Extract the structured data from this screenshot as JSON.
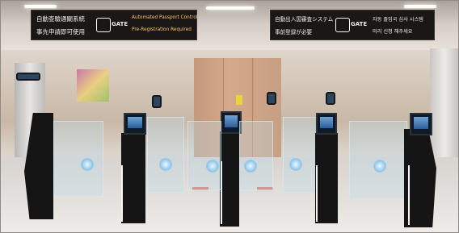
{
  "signs": {
    "left": {
      "line1_cjk": "自動查驗通關系統",
      "line2_cjk": "事先申請即可使用",
      "logo": "GATE",
      "line1_en": "Automated Passport Control",
      "line2_en": "Pre-Registration Required"
    },
    "right": {
      "line1_jp": "自動出入国審査システム",
      "line2_jp": "事前登録が必要",
      "logo": "GATE",
      "line1_kr": "자동 출입국 심사 시스템",
      "line2_kr": "미리 신청 해주세요"
    }
  },
  "colors": {
    "sign_bg": "#1b1716",
    "sign_text": "#f2ede3",
    "gate_body": "#151515",
    "screen_blue": "#2b5f99",
    "glow_blue": "#8fc5ea",
    "wall_tan": "#d4a98a"
  },
  "icons": [
    "g-logo-icon",
    "gate-glow-icon"
  ]
}
